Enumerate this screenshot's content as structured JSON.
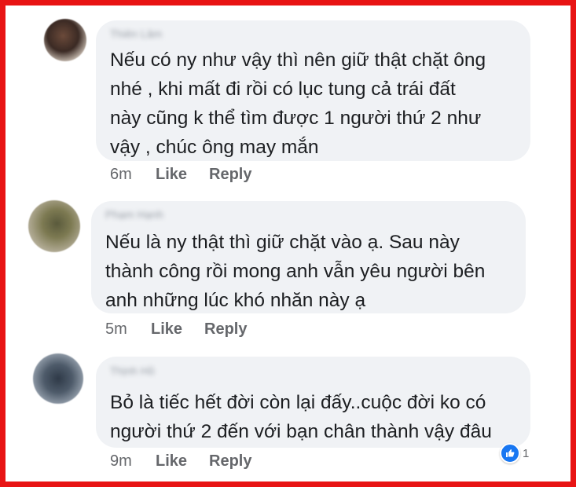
{
  "comments": [
    {
      "author": "Thiên Lâm",
      "lines": [
        "Nếu có ny như vậy thì nên giữ thật chặt ông",
        "nhé , khi mất đi rồi có lục tung cả trái đất",
        "này cũng k thể tìm được 1 người thứ 2 như",
        "vậy , chúc ông may mắn"
      ],
      "time": "6m",
      "like_label": "Like",
      "reply_label": "Reply"
    },
    {
      "author": "Phạm Hạnh",
      "lines": [
        "Nếu là ny thật thì giữ chặt vào ạ. Sau này",
        "thành công rồi mong anh vẫn yêu người bên",
        "anh những lúc khó nhăn này ạ"
      ],
      "time": "5m",
      "like_label": "Like",
      "reply_label": "Reply"
    },
    {
      "author": "Thịnh Hồ",
      "lines": [
        "Bỏ là tiếc hết đời còn lại đấy..cuộc đời ko có",
        "người thứ 2 đến với bạn chân thành vậy đâu"
      ],
      "time": "9m",
      "like_label": "Like",
      "reply_label": "Reply",
      "reaction": {
        "icon": "thumbs-up-icon",
        "count": "1"
      }
    }
  ],
  "colors": {
    "frame_border": "#e81414",
    "bubble_bg": "#f0f2f5",
    "text": "#1c1e21",
    "meta": "#65676b",
    "like_blue": "#1877f2"
  }
}
